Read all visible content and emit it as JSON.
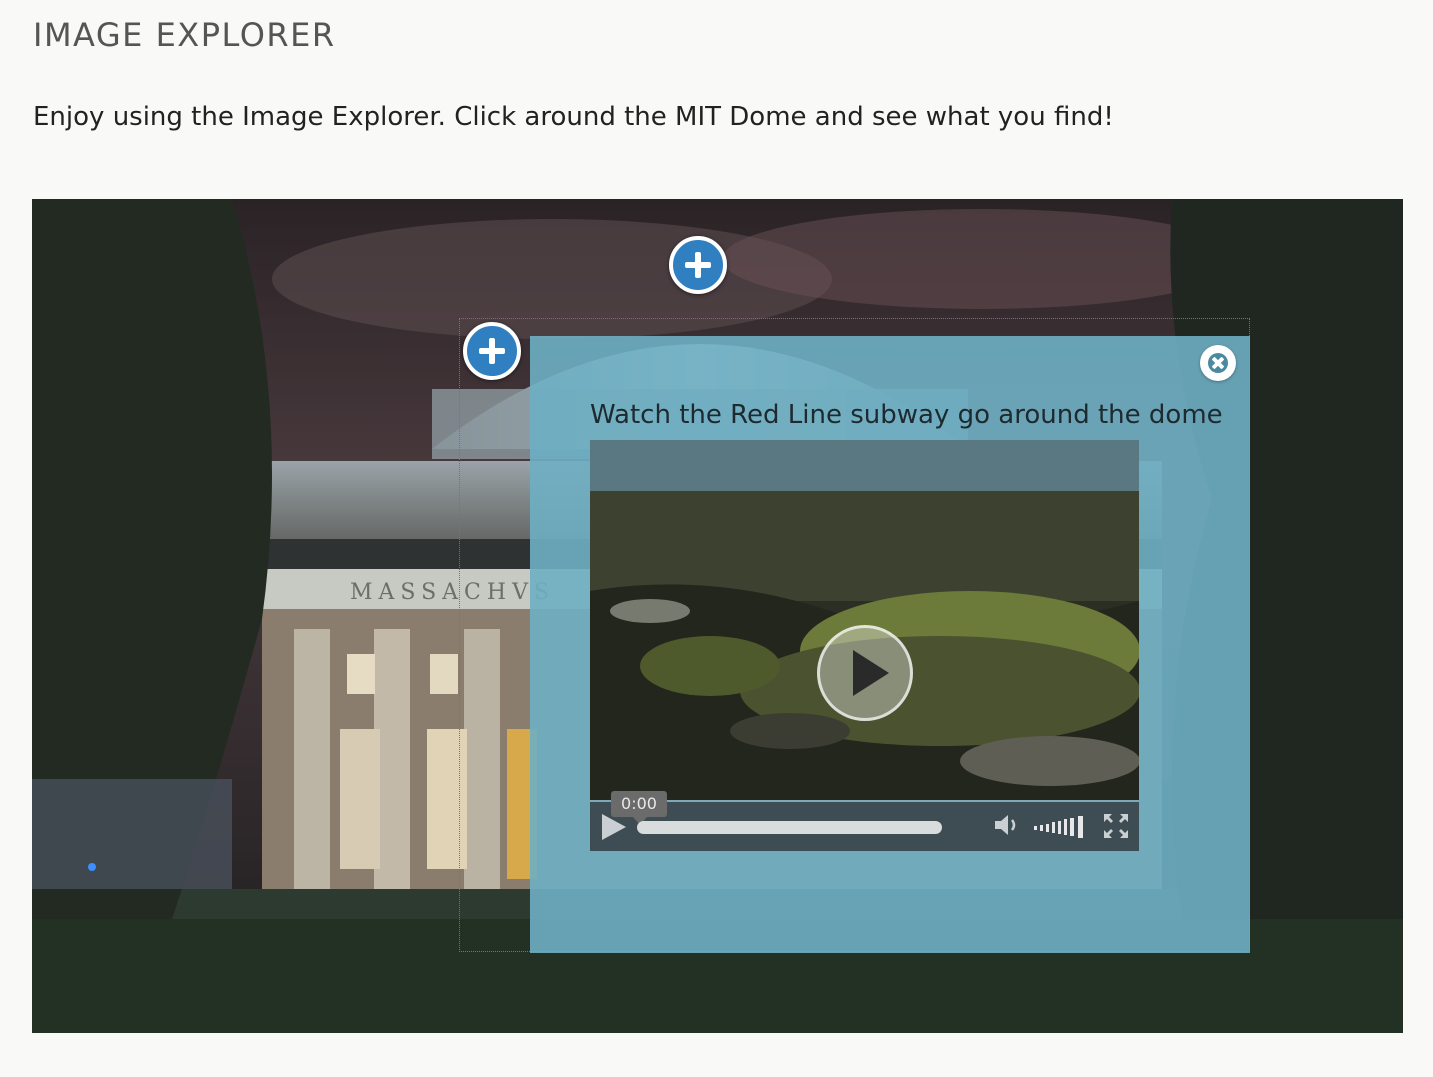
{
  "page": {
    "title": "IMAGE EXPLORER",
    "intro": "Enjoy using the Image Explorer. Click around the MIT Dome and see what you find!"
  },
  "explorer": {
    "background_inscription": "MASSACHVS",
    "hotspots": [
      {
        "name": "dome-top",
        "icon": "plus-circle-icon"
      },
      {
        "name": "dome-left",
        "icon": "plus-circle-icon"
      }
    ]
  },
  "popup": {
    "title": "Watch the Red Line subway go around the dome",
    "close_icon": "close-circle-icon",
    "video": {
      "time": "0:00",
      "progress_fraction": 0,
      "volume_level": 1.0,
      "icons": [
        "play-icon",
        "volume-icon",
        "fullscreen-icon"
      ]
    }
  },
  "colors": {
    "hotspot": "#2f7fc1",
    "popup_bg": "#6eafc3",
    "outline": "#d2486a"
  }
}
